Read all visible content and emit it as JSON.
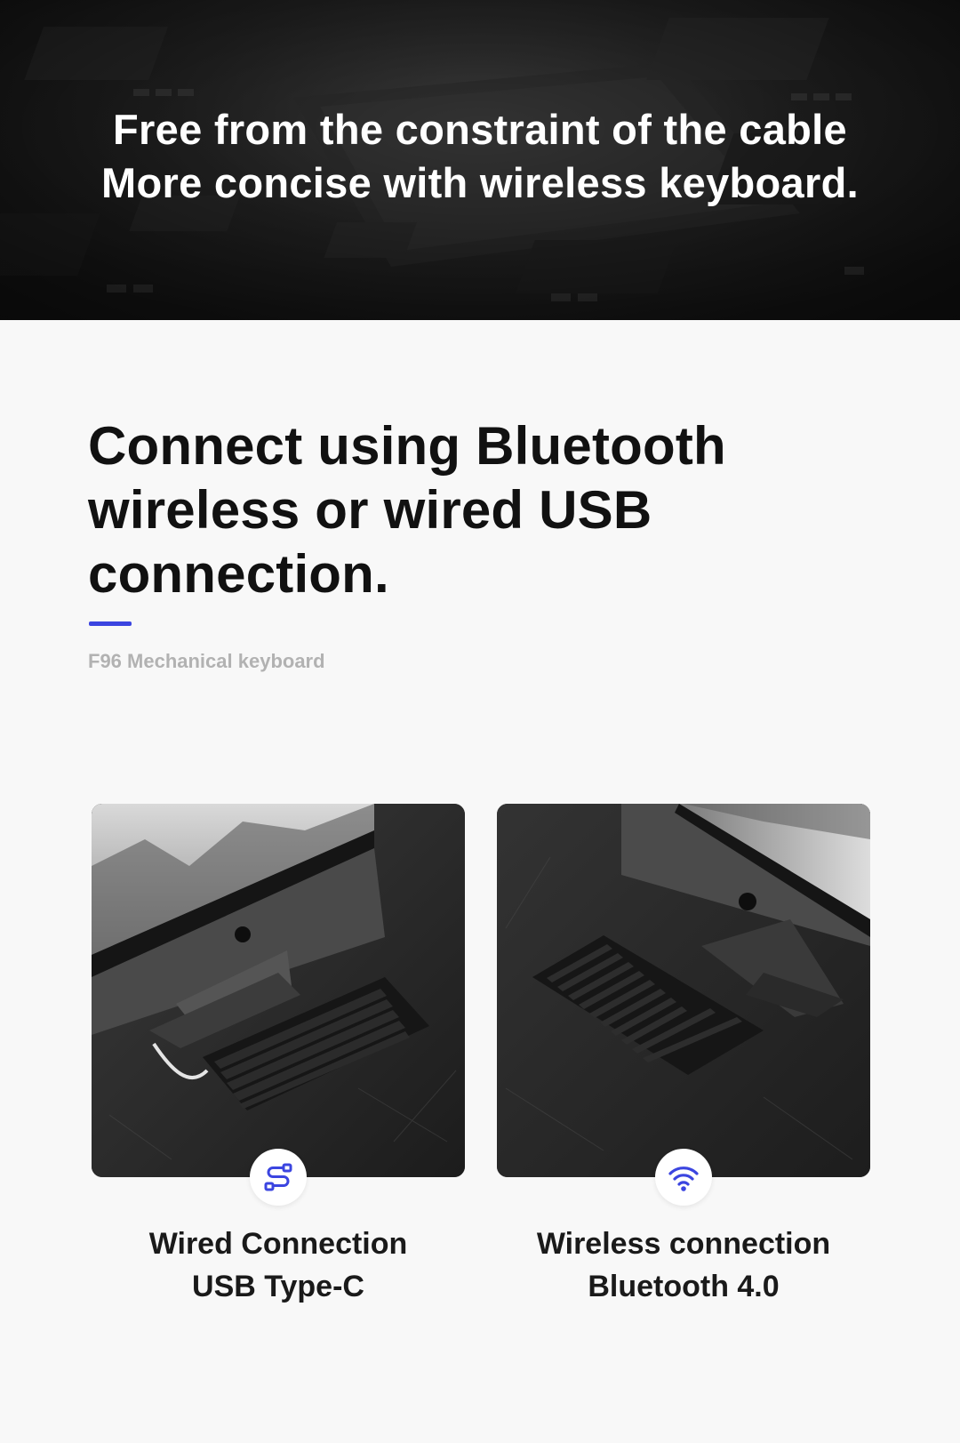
{
  "hero": {
    "line1": "Free from the constraint of the cable",
    "line2": "More concise with wireless keyboard."
  },
  "headline": {
    "line1": "Connect using Bluetooth",
    "line2": "wireless or wired USB",
    "line3": "connection."
  },
  "subtitle": "F96 Mechanical keyboard",
  "accent_color": "#3b45e0",
  "cards": [
    {
      "title": "Wired Connection",
      "subtitle": "USB Type-C",
      "icon": "usb-cable-icon"
    },
    {
      "title": "Wireless connection",
      "subtitle": "Bluetooth 4.0",
      "icon": "wifi-icon"
    }
  ]
}
